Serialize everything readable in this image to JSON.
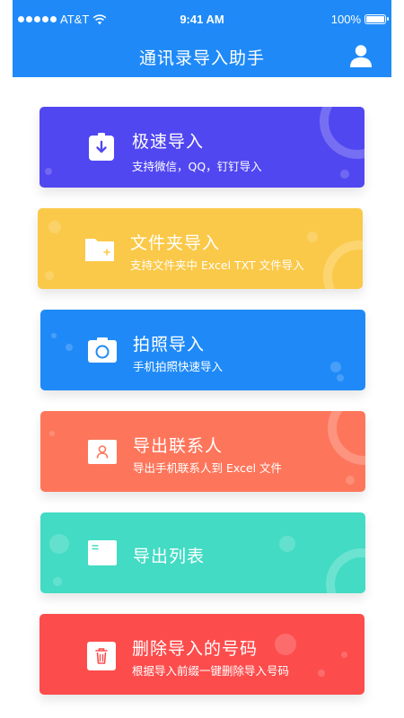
{
  "status_bar": {
    "carrier": "AT&T",
    "time": "9:41 AM",
    "battery": "100%"
  },
  "header": {
    "title": "通讯录导入助手",
    "profile_icon": "person-icon"
  },
  "cards": [
    {
      "title": "极速导入",
      "subtitle": "支持微信，QQ，钉钉导入",
      "color": "#5147f0",
      "icon": "download-icon"
    },
    {
      "title": "文件夹导入",
      "subtitle": "支持文件夹中 Excel TXT 文件导入",
      "color": "#fbc949",
      "icon": "folder-icon"
    },
    {
      "title": "拍照导入",
      "subtitle": "手机拍照快速导入",
      "color": "#1f8af7",
      "icon": "camera-icon"
    },
    {
      "title": "导出联系人",
      "subtitle": "导出手机联系人到 Excel 文件",
      "color": "#fd765b",
      "icon": "contact-card-icon"
    },
    {
      "title": "导出列表",
      "subtitle": "",
      "color": "#43dbc4",
      "icon": "list-icon"
    },
    {
      "title": "删除导入的号码",
      "subtitle": "根据导入前缀一键删除导入号码",
      "color": "#fd4c4c",
      "icon": "trash-icon"
    }
  ]
}
